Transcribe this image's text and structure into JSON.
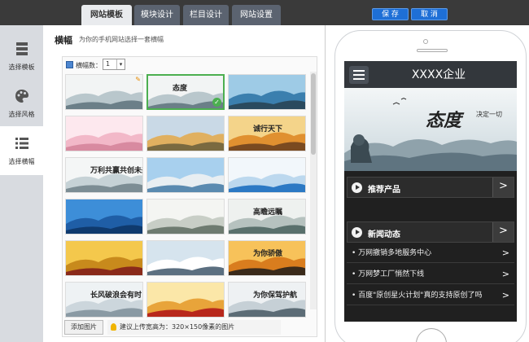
{
  "tabs": [
    {
      "label": "网站模板",
      "active": true
    },
    {
      "label": "模块设计",
      "active": false
    },
    {
      "label": "栏目设计",
      "active": false
    },
    {
      "label": "网站设置",
      "active": false
    }
  ],
  "actions": {
    "save_label": "保 存",
    "cancel_label": "取 消"
  },
  "sidebar": {
    "items": [
      {
        "label": "选择模板",
        "icon": "template-icon",
        "active": false
      },
      {
        "label": "选择风格",
        "icon": "palette-icon",
        "active": false
      },
      {
        "label": "选择横幅",
        "icon": "list-icon",
        "active": true
      }
    ]
  },
  "main": {
    "title": "横幅",
    "subtitle": "为你的手机网站选择一套横幅",
    "count_label": "横幅数：",
    "count_value": "1",
    "add_button": "添加图片",
    "tip": "建议上传宽高为：320×150像素的图片",
    "banners": [
      {
        "id": 1,
        "theme": "ink-lion",
        "selected": false
      },
      {
        "id": 2,
        "theme": "ink-lion",
        "selected": true,
        "caption": "态度"
      },
      {
        "id": 3,
        "theme": "pier",
        "selected": false
      },
      {
        "id": 4,
        "theme": "cherry",
        "selected": false
      },
      {
        "id": 5,
        "theme": "autumn-field",
        "selected": false
      },
      {
        "id": 6,
        "theme": "sunset-tree",
        "selected": false,
        "caption": "诚行天下"
      },
      {
        "id": 7,
        "theme": "mountain-text",
        "selected": false,
        "caption": "万利共赢共创未来"
      },
      {
        "id": 8,
        "theme": "lighthouse",
        "selected": false
      },
      {
        "id": 9,
        "theme": "blue-sphere",
        "selected": false
      },
      {
        "id": 10,
        "theme": "blue-clock",
        "selected": false
      },
      {
        "id": 11,
        "theme": "eagle",
        "selected": false
      },
      {
        "id": 12,
        "theme": "ink-mountain",
        "selected": false,
        "caption": "高瞻远瞩"
      },
      {
        "id": 13,
        "theme": "gold-chair",
        "selected": false
      },
      {
        "id": 14,
        "theme": "building",
        "selected": false
      },
      {
        "id": 15,
        "theme": "sunset-people",
        "selected": false,
        "caption": "为你骄傲"
      },
      {
        "id": 16,
        "theme": "sailboat",
        "selected": false,
        "caption": "长风破浪会有时"
      },
      {
        "id": 17,
        "theme": "gold-red",
        "selected": false
      },
      {
        "id": 18,
        "theme": "dock",
        "selected": false,
        "caption": "为你保驾护航"
      }
    ]
  },
  "preview": {
    "site_title": "XXXX企业",
    "banner_caption": "态度",
    "banner_sub": "决定一切",
    "sections": [
      {
        "title": "推荐产品",
        "more": ">"
      },
      {
        "title": "新闻动态",
        "more": ">"
      }
    ],
    "news": [
      "万网撤销多地服务中心",
      "万网梦工厂悄然下线",
      "百度\"原创星火计划\"真的支持原创了吗"
    ]
  },
  "colors": {
    "accent_blue": "#1e6fd6",
    "selected_green": "#4caf50",
    "dark_bar": "#3a3a3a"
  }
}
